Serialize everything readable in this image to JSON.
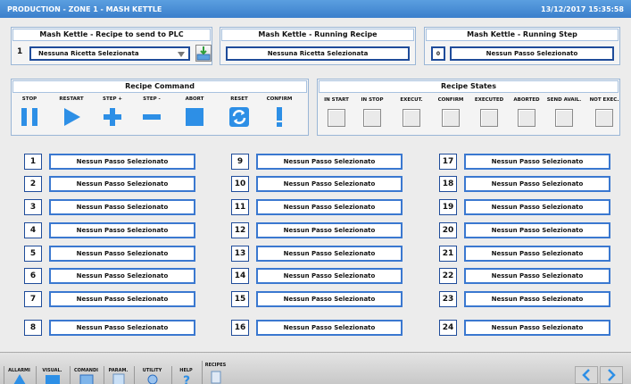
{
  "title_bar": {
    "title": "PRODUCTION - ZONE 1 - MASH KETTLE",
    "datetime": "13/12/2017 15:35:58"
  },
  "recipe_to_send": {
    "title": "Mash Kettle - Recipe to send to PLC",
    "index": "1",
    "selected": "Nessuna Ricetta Selezionata"
  },
  "running_recipe": {
    "title": "Mash Kettle - Running Recipe",
    "value": "Nessuna Ricetta Selezionata"
  },
  "running_step": {
    "title": "Mash Kettle - Running Step",
    "step_number": "0",
    "value": "Nessun Passo Selezionato"
  },
  "recipe_command": {
    "title": "Recipe Command",
    "buttons": [
      {
        "label": "STOP",
        "icon": "pause-icon"
      },
      {
        "label": "RESTART",
        "icon": "play-icon"
      },
      {
        "label": "STEP +",
        "icon": "plus-icon"
      },
      {
        "label": "STEP -",
        "icon": "minus-icon"
      },
      {
        "label": "ABORT",
        "icon": "stop-square-icon"
      },
      {
        "label": "RESET",
        "icon": "refresh-icon"
      },
      {
        "label": "CONFIRM",
        "icon": "exclamation-icon"
      }
    ]
  },
  "recipe_states": {
    "title": "Recipe States",
    "states": [
      "IN START",
      "IN STOP",
      "EXECUT.",
      "CONFIRM",
      "EXECUTED",
      "ABORTED",
      "SEND AVAIL.",
      "NOT EXEC."
    ]
  },
  "steps": [
    {
      "n": "1",
      "value": "Nessun Passo Selezionato"
    },
    {
      "n": "2",
      "value": "Nessun Passo Selezionato"
    },
    {
      "n": "3",
      "value": "Nessun Passo Selezionato"
    },
    {
      "n": "4",
      "value": "Nessun Passo Selezionato"
    },
    {
      "n": "5",
      "value": "Nessun Passo Selezionato"
    },
    {
      "n": "6",
      "value": "Nessun Passo Selezionato"
    },
    {
      "n": "7",
      "value": "Nessun Passo Selezionato"
    },
    {
      "n": "8",
      "value": "Nessun Passo Selezionato"
    },
    {
      "n": "9",
      "value": "Nessun Passo Selezionato"
    },
    {
      "n": "10",
      "value": "Nessun Passo Selezionato"
    },
    {
      "n": "11",
      "value": "Nessun Passo Selezionato"
    },
    {
      "n": "12",
      "value": "Nessun Passo Selezionato"
    },
    {
      "n": "13",
      "value": "Nessun Passo Selezionato"
    },
    {
      "n": "14",
      "value": "Nessun Passo Selezionato"
    },
    {
      "n": "15",
      "value": "Nessun Passo Selezionato"
    },
    {
      "n": "16",
      "value": "Nessun Passo Selezionato"
    },
    {
      "n": "17",
      "value": "Nessun Passo Selezionato"
    },
    {
      "n": "18",
      "value": "Nessun Passo Selezionato"
    },
    {
      "n": "19",
      "value": "Nessun Passo Selezionato"
    },
    {
      "n": "20",
      "value": "Nessun Passo Selezionato"
    },
    {
      "n": "21",
      "value": "Nessun Passo Selezionato"
    },
    {
      "n": "22",
      "value": "Nessun Passo Selezionato"
    },
    {
      "n": "23",
      "value": "Nessun Passo Selezionato"
    },
    {
      "n": "24",
      "value": "Nessun Passo Selezionato"
    }
  ],
  "bottom_nav": [
    {
      "label": "ALLARMI",
      "icon": "alarm-icon"
    },
    {
      "label": "VISUAL.",
      "icon": "visual-icon"
    },
    {
      "label": "COMANDI",
      "icon": "commands-icon"
    },
    {
      "label": "PARAM.",
      "icon": "params-icon"
    },
    {
      "label": "UTILITY",
      "icon": "utility-icon"
    },
    {
      "label": "HELP",
      "icon": "help-icon"
    },
    {
      "label": "RECIPES",
      "icon": "recipes-icon"
    }
  ],
  "colors": {
    "accent": "#3b7fcc",
    "button_blue": "#2d8fe6",
    "border": "#1f4c9a"
  }
}
